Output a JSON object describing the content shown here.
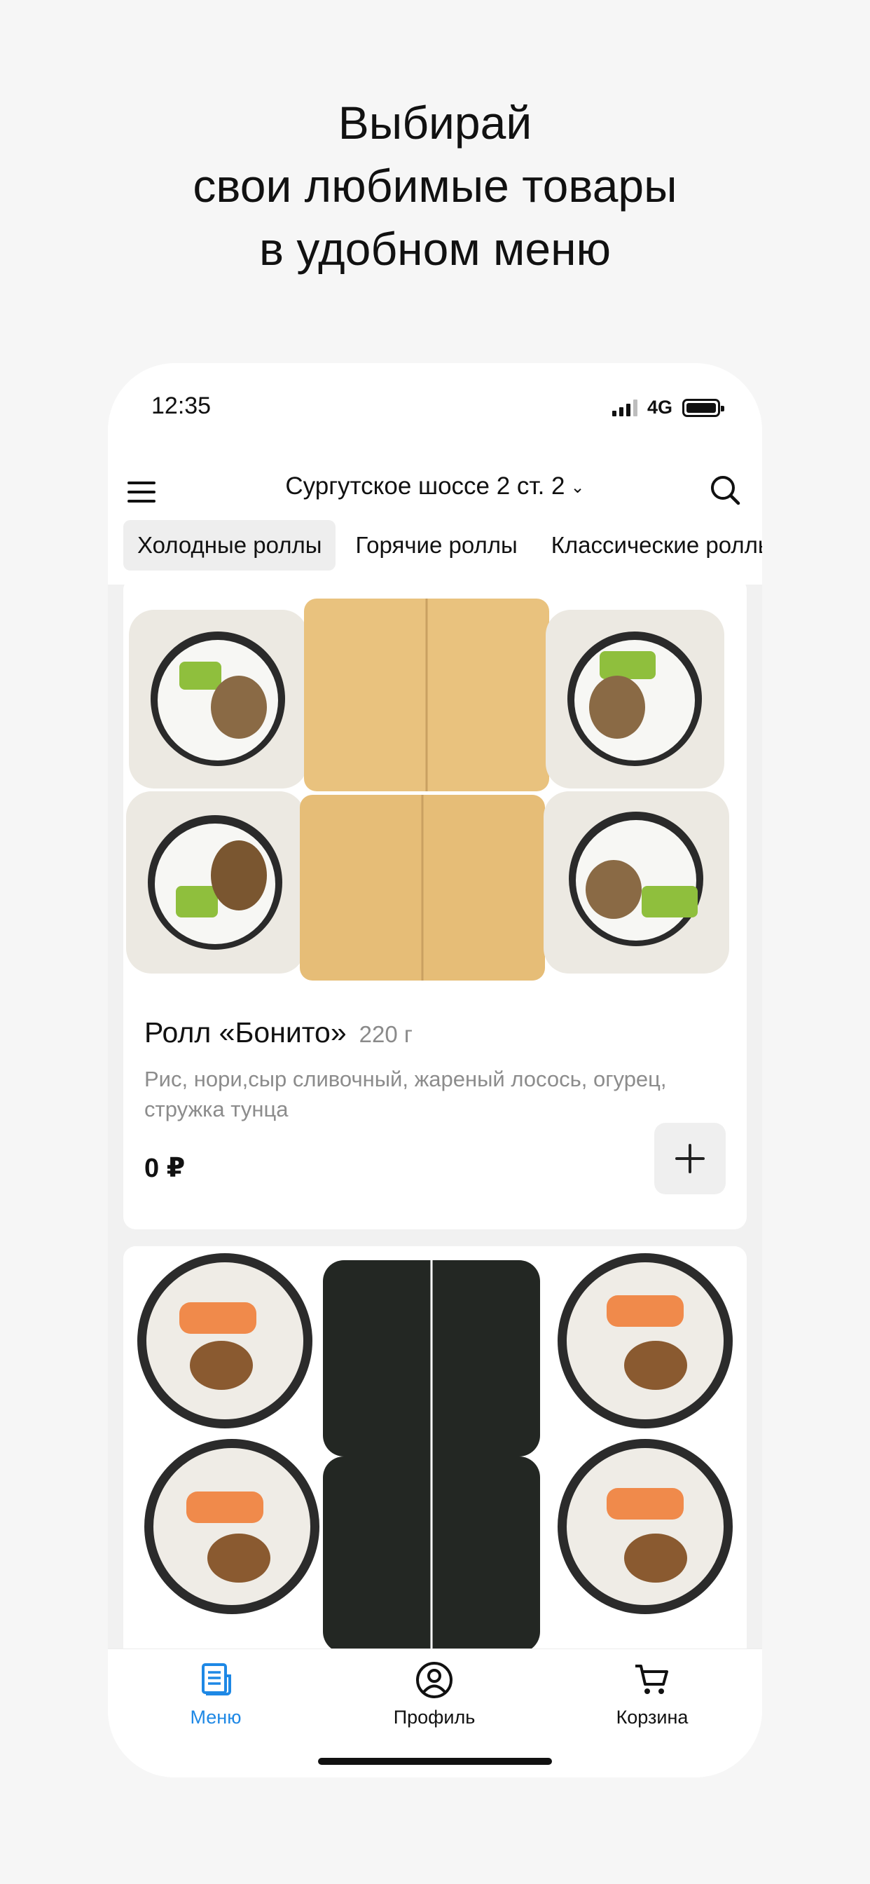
{
  "headline": {
    "line1": "Выбирай",
    "line2": "свои любимые товары",
    "line3": "в удобном меню"
  },
  "status_bar": {
    "time": "12:35",
    "network": "4G"
  },
  "header": {
    "address": "Сургутское шоссе 2 ст. 2",
    "menu_icon": "hamburger-icon",
    "search_icon": "search-icon"
  },
  "tabs": [
    {
      "label": "Холодные роллы",
      "active": true
    },
    {
      "label": "Горячие роллы",
      "active": false
    },
    {
      "label": "Классические роллы",
      "active": false
    }
  ],
  "products": [
    {
      "name": "Ролл «Бонито»",
      "weight": "220 г",
      "description": "Рис, нори,сыр сливочный, жареный лосось, огурец, стружка тунца",
      "price": "0 ₽"
    }
  ],
  "bottom_nav": [
    {
      "label": "Меню",
      "icon": "menu-document-icon",
      "active": true
    },
    {
      "label": "Профиль",
      "icon": "profile-icon",
      "active": false
    },
    {
      "label": "Корзина",
      "icon": "cart-icon",
      "active": false
    }
  ],
  "colors": {
    "accent": "#1e88e5",
    "background": "#f6f6f6",
    "text": "#111111",
    "muted": "#8c8c8c"
  }
}
